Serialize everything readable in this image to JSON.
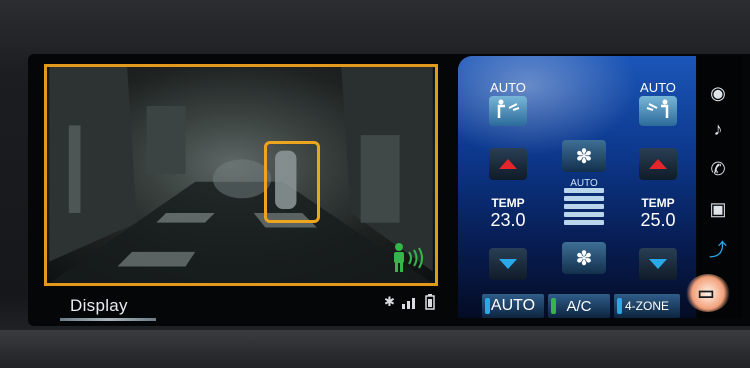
{
  "night_view": {
    "display_label": "Display"
  },
  "climate": {
    "left": {
      "auto_label": "AUTO",
      "temp_label": "TEMP",
      "temp_value": "23.0"
    },
    "right": {
      "auto_label": "AUTO",
      "temp_label": "TEMP",
      "temp_value": "25.0"
    },
    "fan": {
      "mode_label": "AUTO"
    },
    "buttons": {
      "auto": "AUTO",
      "ac": "A/C",
      "zone": "4-ZONE"
    }
  },
  "side_menu": {
    "items": [
      {
        "icon": "navigation-icon",
        "glyph": "◉"
      },
      {
        "icon": "music-icon",
        "glyph": "♪"
      },
      {
        "icon": "phone-icon",
        "glyph": "✆"
      },
      {
        "icon": "picture-icon",
        "glyph": "▣"
      },
      {
        "icon": "seat-climate-icon",
        "glyph": "⤴"
      },
      {
        "icon": "camera-display-icon",
        "glyph": "▭"
      }
    ]
  },
  "colors": {
    "highlight_orange": "#e39a1c",
    "pedestrian_green": "#35b54a",
    "temp_up_red": "#e4262c",
    "temp_down_blue": "#2aa9e8",
    "climate_blue": "#1b56b8"
  }
}
